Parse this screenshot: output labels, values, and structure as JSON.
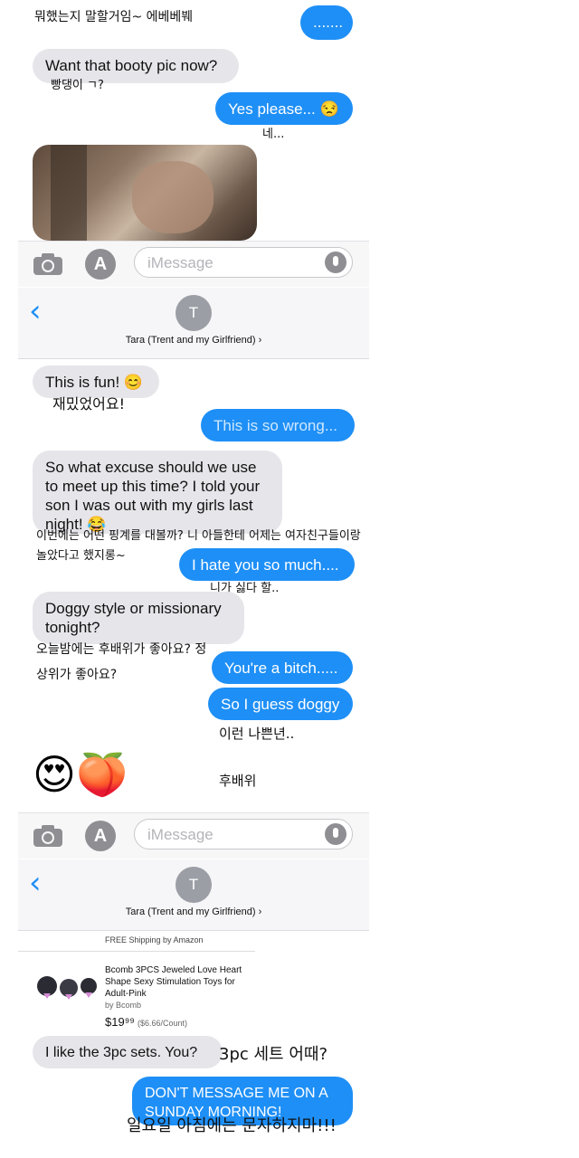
{
  "top": {
    "cut_korean": "뭐했는지 말할거임~ 에베베붸",
    "sent_dots": "......."
  },
  "section1": {
    "recv1": "Want that booty pic now?",
    "recv1_ko": "빵댕이 ㄱ?",
    "sent1": "Yes please... 😒",
    "sent1_ko": "네..."
  },
  "toolbar": {
    "placeholder": "iMessage",
    "app_icon": "A"
  },
  "header": {
    "back": "‹",
    "avatar_initial": "T",
    "contact_name": "Tara (Trent and my Girlfriend) ›"
  },
  "section2": {
    "recv_fun": "This is fun! 😊",
    "recv_fun_ko": "재밌었어요!",
    "sent_wrong": "This is so wrong...",
    "recv_excuse": "So what excuse should we use to meet up this time? I told your son I was out with my girls last night! 😂",
    "recv_excuse_ko": "이번에는 어떤 핑계를 대볼까? 니 아들한테 어제는 여자친구들이랑 놀았다고 했지롱~",
    "sent_hate": "I hate you so much....",
    "sent_hate_ko": "니가 싫다 할..",
    "recv_doggy": "Doggy style or missionary tonight?",
    "recv_doggy_ko": "오늘밤에는 후배위가 좋아요? 정상위가 좋아요?",
    "sent_bitch": "You're a bitch.....",
    "sent_guess": "So I guess doggy",
    "sent_ko": "이런 나쁜년..",
    "emoji_row": "😍🍑",
    "emoji_ko": "후배위"
  },
  "section3": {
    "shipping": "FREE Shipping by Amazon",
    "product_title": "Bcomb 3PCS Jeweled Love Heart Shape Sexy Stimulation Toys for Adult-Pink",
    "product_by": "by Bcomb",
    "price": "$19⁹⁹",
    "price_unit": "($6.66/Count)",
    "recv_3pc": "I like the 3pc sets. You?",
    "recv_3pc_ko": "3pc 세트 어때?",
    "sent_sunday": "DON'T MESSAGE ME ON A SUNDAY MORNING!",
    "sent_sunday_ko": "일요일 아침에는 문자하지마!!!"
  }
}
